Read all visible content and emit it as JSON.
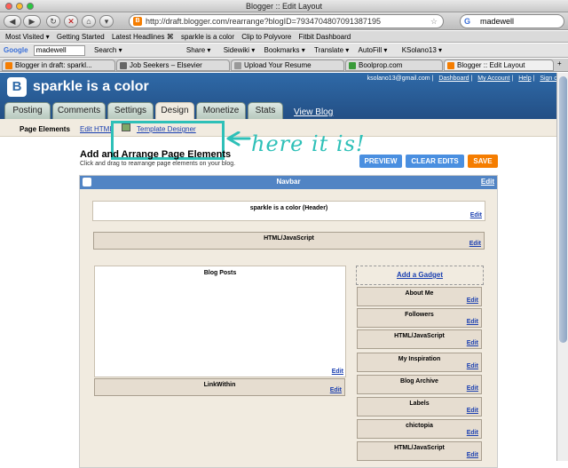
{
  "window": {
    "title": "Blogger :: Edit Layout"
  },
  "browser": {
    "url": "http://draft.blogger.com/rearrange?blogID=7934704807091387195",
    "search_value": "madewell",
    "bookmarks": [
      "Most Visited ▾",
      "Getting Started",
      "Latest Headlines ⌘",
      "sparkle is a color",
      "Clip to Polyvore",
      "Fitbit Dashboard"
    ],
    "toolbar": {
      "google_label": "Google",
      "google_value": "madewell",
      "items": [
        "Search ▾",
        "Share ▾",
        "Sidewiki ▾",
        "Bookmarks ▾",
        "Translate ▾",
        "AutoFill ▾",
        "KSolano13 ▾"
      ]
    },
    "tabs": [
      "Blogger in draft: sparkl...",
      "Job Seekers – Elsevier",
      "Upload Your Resume",
      "Boolprop.com",
      "Blogger :: Edit Layout"
    ]
  },
  "blogger": {
    "blog_name": "sparkle is a color",
    "user": "ksolano13@gmail.com",
    "links": [
      "Dashboard",
      "My Account",
      "Help",
      "Sign out"
    ],
    "main_tabs": [
      "Posting",
      "Comments",
      "Settings",
      "Design",
      "Monetize",
      "Stats"
    ],
    "view_blog": "View Blog",
    "sub_tabs": [
      "Page Elements",
      "Edit HTML",
      "Template Designer"
    ],
    "annotation": "here it is!",
    "heading": "Add and Arrange Page Elements",
    "subheading": "Click and drag to rearrange page elements on your blog.",
    "buttons": {
      "preview": "PREVIEW",
      "clear": "CLEAR EDITS",
      "save": "SAVE"
    },
    "edit_label": "Edit",
    "navbar_label": "Navbar",
    "header_widget": "sparkle is a color (Header)",
    "html_js_top": "HTML/JavaScript",
    "blog_posts": "Blog Posts",
    "linkwithin": "LinkWithin",
    "add_gadget": "Add a Gadget",
    "sidebar_widgets": [
      "About Me",
      "Followers",
      "HTML/JavaScript",
      "My Inspiration",
      "Blog Archive",
      "Labels",
      "chictopia",
      "HTML/JavaScript"
    ]
  },
  "colors": {
    "blogger_blue": "#2f6aa8",
    "save_orange": "#f57d00",
    "button_blue": "#4a8fe0",
    "annotation": "#2ec0b8"
  }
}
